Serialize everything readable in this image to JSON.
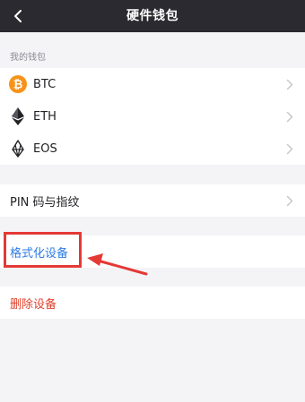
{
  "header": {
    "title": "硬件钱包",
    "back_icon": "chevron-left-icon"
  },
  "wallets": {
    "section_label": "我的钱包",
    "items": [
      {
        "label": "BTC",
        "icon": "bitcoin-icon",
        "icon_color": "#f7931a"
      },
      {
        "label": "ETH",
        "icon": "ethereum-icon",
        "icon_color": "#222226"
      },
      {
        "label": "EOS",
        "icon": "eos-icon",
        "icon_color": "#222226"
      }
    ]
  },
  "security": {
    "pin_label": "PIN 码与指纹"
  },
  "device": {
    "format_label": "格式化设备",
    "format_color": "#2d7be5",
    "delete_label": "删除设备",
    "delete_color": "#e0422e"
  },
  "annotation": {
    "color": "#e53935"
  }
}
